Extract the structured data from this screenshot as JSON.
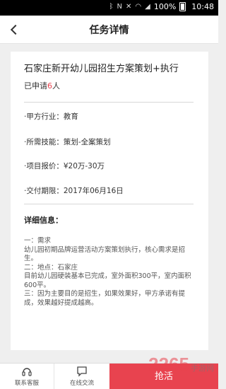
{
  "status_bar": {
    "battery": "100%",
    "time": "10:48",
    "icons": [
      "bluetooth-icon",
      "nfc-icon",
      "mute-icon",
      "wifi-icon",
      "signal-icon",
      "battery-icon"
    ]
  },
  "header": {
    "title": "任务详情",
    "back_icon": "chevron-left-icon"
  },
  "task": {
    "title": "石家庄新开幼儿园招生方案策划+执行",
    "applied_prefix": "已申请",
    "applied_count": "6",
    "applied_suffix": "人",
    "rows": [
      {
        "label": "·甲方行业：",
        "value": "教育"
      },
      {
        "label": "·所需技能：",
        "value": "策划-全案策划"
      },
      {
        "label": "·项目报价：",
        "value": "¥20万-30万"
      },
      {
        "label": "·交付期限：",
        "value": "2017年06月16日"
      }
    ],
    "detail_label": "详细信息：",
    "detail_lines": [
      "一：需求",
      "幼儿园初期品牌运营活动方案策划执行，核心需求是招生。",
      "二：地点：石家庄",
      "目前幼儿园硬装基本已完成，室外面积300平，室内面积600平。",
      "三：因为主要目的是招生，如果效果好，甲方承诺有提成，效果越好提成越高。"
    ]
  },
  "bottom_bar": {
    "contact_label": "联系客服",
    "chat_label": "在线交流",
    "grab_label": "抢活"
  },
  "watermark": {
    "text": "2265",
    "sub": "手游网"
  },
  "colors": {
    "accent": "#e8434f",
    "background": "#efefef"
  }
}
